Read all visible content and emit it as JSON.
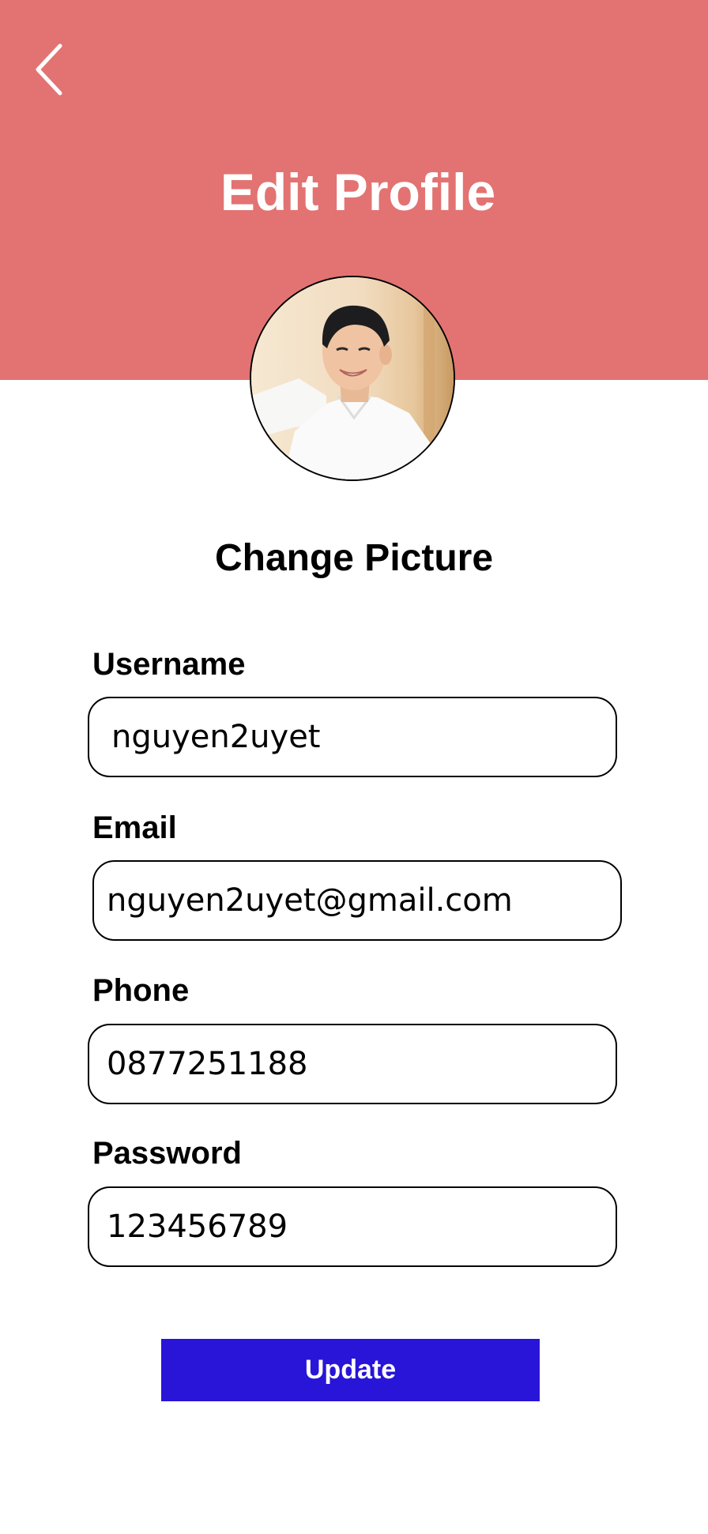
{
  "header": {
    "title": "Edit Profile",
    "background_color": "#e27372",
    "back_icon": "chevron-left-icon"
  },
  "profile": {
    "change_picture_label": "Change Picture"
  },
  "form": {
    "username": {
      "label": "Username",
      "value": "nguyen2uyet"
    },
    "email": {
      "label": "Email",
      "value": "nguyen2uyet@gmail.com"
    },
    "phone": {
      "label": "Phone",
      "value": "0877251188"
    },
    "password": {
      "label": "Password",
      "value": "123456789"
    }
  },
  "actions": {
    "update_label": "Update",
    "update_color": "#2815d8"
  }
}
